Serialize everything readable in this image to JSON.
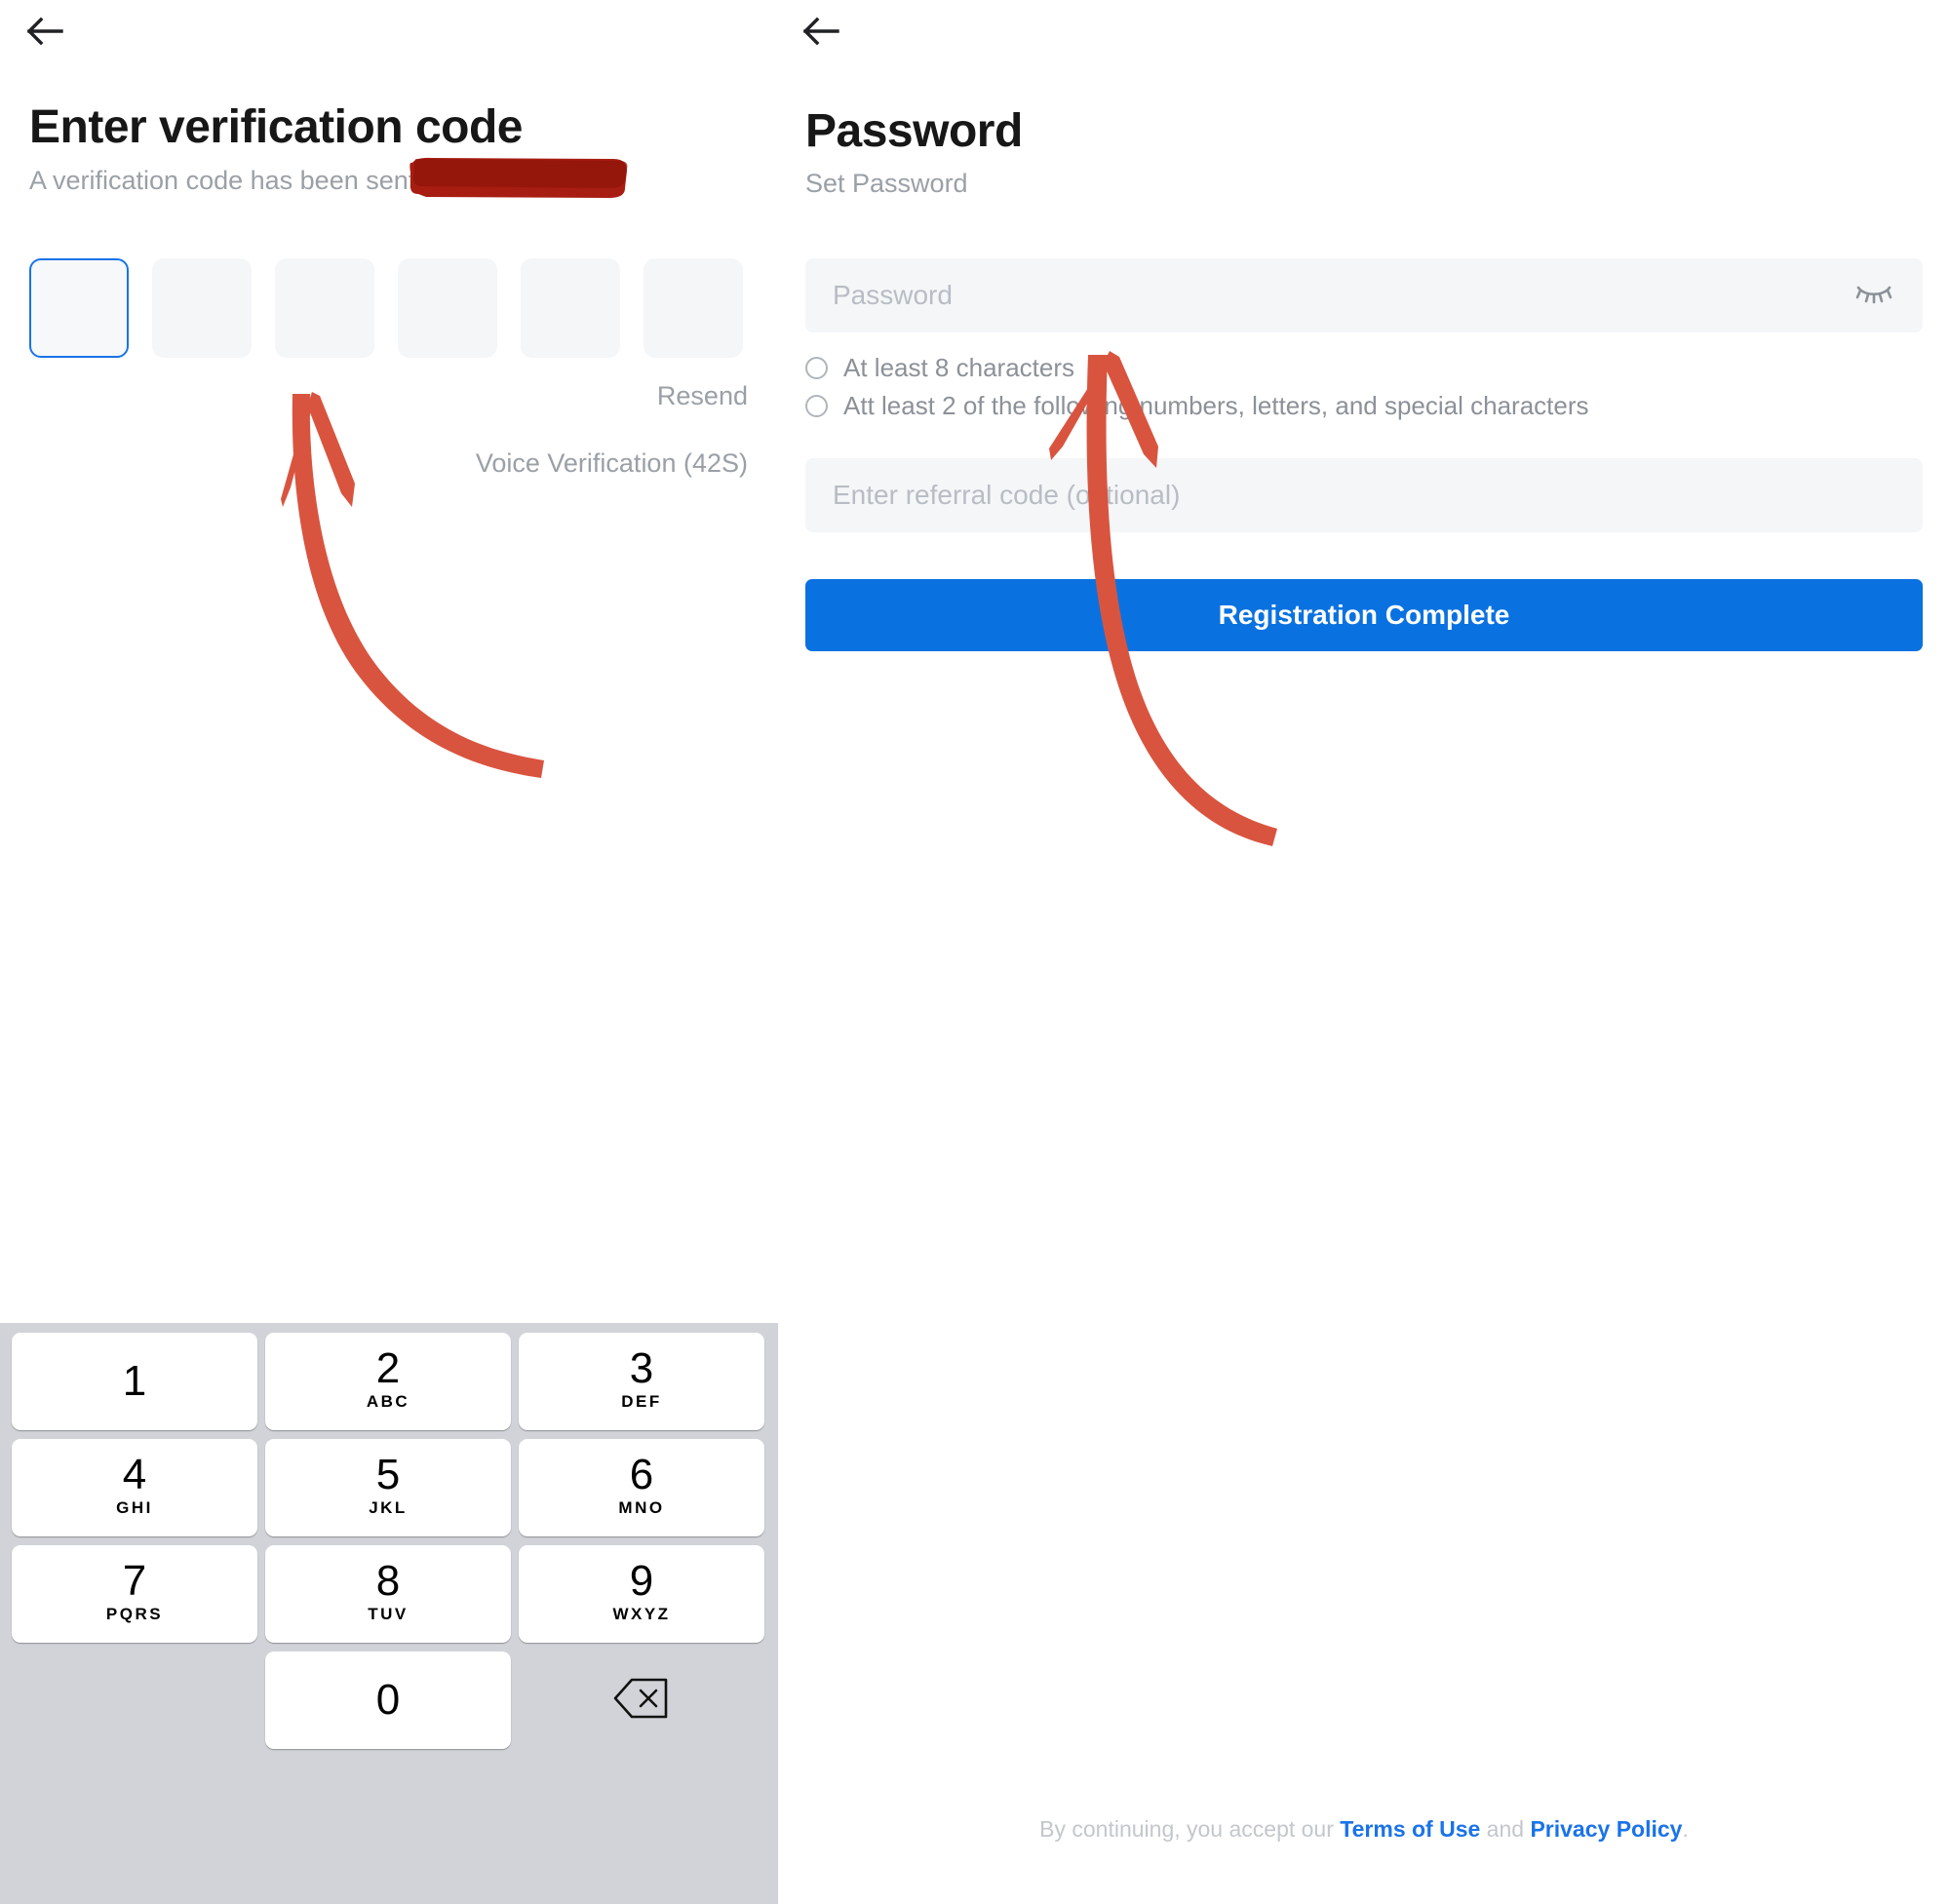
{
  "colors": {
    "accent_blue": "#0a72e0",
    "link_blue": "#1a73e8",
    "field_bg": "#f4f6f8",
    "keypad_bg": "#d1d3d8",
    "muted_text": "#9aa0a6",
    "annotation_red": "#d9543f",
    "redaction_red": "#a81d12"
  },
  "left_panel": {
    "back_icon": "arrow-left-icon",
    "title": "Enter verification code",
    "subtitle": "A verification code has been sent to",
    "otp": {
      "count": 6,
      "active_index": 0,
      "values": [
        "",
        "",
        "",
        "",
        "",
        ""
      ]
    },
    "resend_label": "Resend",
    "voice_label": "Voice Verification (42S)",
    "keypad": {
      "rows": [
        [
          {
            "digit": "1",
            "letters": ""
          },
          {
            "digit": "2",
            "letters": "ABC"
          },
          {
            "digit": "3",
            "letters": "DEF"
          }
        ],
        [
          {
            "digit": "4",
            "letters": "GHI"
          },
          {
            "digit": "5",
            "letters": "JKL"
          },
          {
            "digit": "6",
            "letters": "MNO"
          }
        ],
        [
          {
            "digit": "7",
            "letters": "PQRS"
          },
          {
            "digit": "8",
            "letters": "TUV"
          },
          {
            "digit": "9",
            "letters": "WXYZ"
          }
        ]
      ],
      "bottom": {
        "blank": "",
        "zero": "0",
        "backspace_icon": "backspace-icon"
      }
    }
  },
  "right_panel": {
    "back_icon": "arrow-left-icon",
    "title": "Password",
    "subtitle": "Set Password",
    "password_field": {
      "placeholder": "Password",
      "value": "",
      "toggle_icon": "eye-off-icon"
    },
    "requirements": [
      "At least 8 characters",
      "Att least 2 of the following numbers, letters, and special characters"
    ],
    "referral_field": {
      "placeholder": "Enter referral code (optional)",
      "value": ""
    },
    "submit_label": "Registration Complete",
    "footer": {
      "prefix": "By continuing, you accept our ",
      "terms_link": "Terms of Use",
      "middle": " and ",
      "privacy_link": "Privacy Policy",
      "suffix": "."
    }
  }
}
